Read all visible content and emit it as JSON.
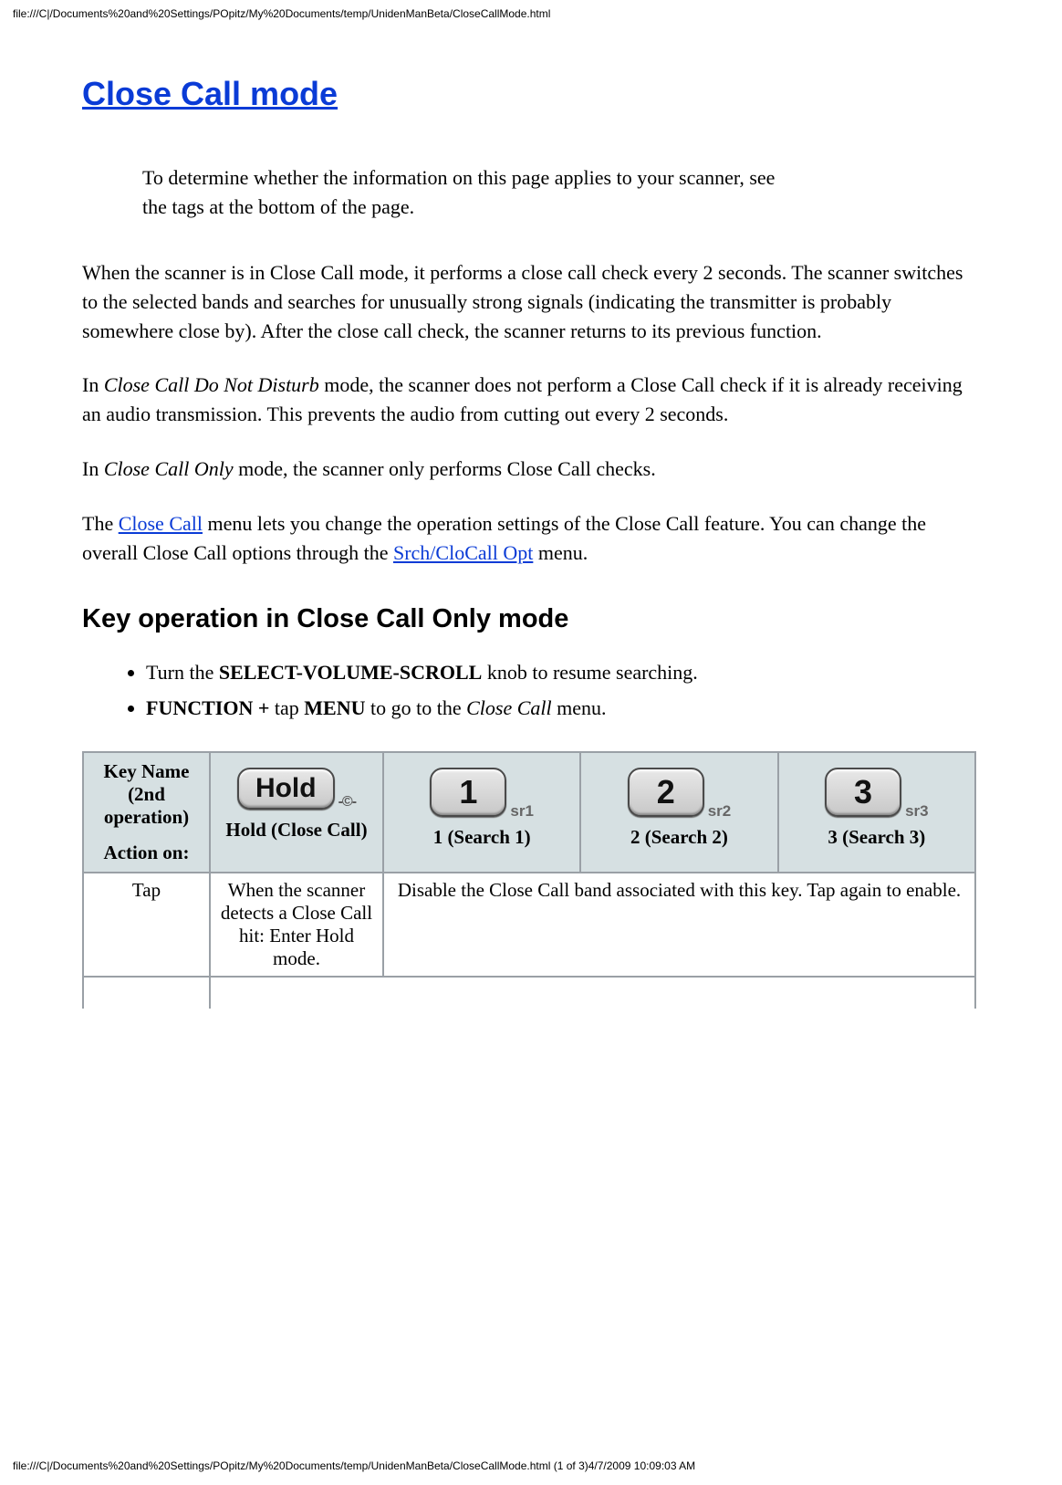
{
  "header_path": "file:///C|/Documents%20and%20Settings/POpitz/My%20Documents/temp/UnidenManBeta/CloseCallMode.html",
  "footer_path": "file:///C|/Documents%20and%20Settings/POpitz/My%20Documents/temp/UnidenManBeta/CloseCallMode.html (1 of 3)4/7/2009 10:09:03 AM",
  "title": "Close Call mode",
  "intro_note": "To determine whether the information on this page applies to your scanner, see the tags at the bottom of the page.",
  "para1": "When the scanner is in Close Call mode, it performs a close call check every 2 seconds. The scanner switches to the selected bands and searches for unusually strong signals (indicating the transmitter is probably somewhere close by). After the close call check, the scanner returns to its previous function.",
  "para2_pre": "In ",
  "para2_em": "Close Call Do Not Disturb",
  "para2_post": " mode, the scanner does not perform a Close Call check if it is already receiving an audio transmission. This prevents the audio from cutting out every 2 seconds.",
  "para3_pre": "In ",
  "para3_em": "Close Call Only",
  "para3_post": " mode, the scanner only performs Close Call checks.",
  "para4_pre": "The ",
  "para4_link1": "Close Call",
  "para4_mid": " menu lets you change the operation settings of the Close Call feature. You can change the overall Close Call options through the ",
  "para4_link2": "Srch/CloCall Opt",
  "para4_post": " menu.",
  "section_heading": "Key operation in Close Call Only mode",
  "bullet1_pre": "Turn the ",
  "bullet1_bold": "SELECT-VOLUME-SCROLL",
  "bullet1_post": " knob to resume searching.",
  "bullet2_b1": "FUNCTION +",
  "bullet2_mid": " tap ",
  "bullet2_b2": "MENU",
  "bullet2_post1": " to go to the ",
  "bullet2_em": "Close Call",
  "bullet2_post2": " menu.",
  "table": {
    "head_col_line1": "Key Name (2nd operation)",
    "head_col_line2": "Action on:",
    "keys": [
      {
        "cap": "Hold",
        "sub": "-©-",
        "label": "Hold (Close Call)"
      },
      {
        "cap": "1",
        "sub": "sr1",
        "label": "1 (Search 1)"
      },
      {
        "cap": "2",
        "sub": "sr2",
        "label": "2 (Search 2)"
      },
      {
        "cap": "3",
        "sub": "sr3",
        "label": "3 (Search 3)"
      }
    ],
    "row_label_tap": "Tap",
    "row_tap_hold": "When the scanner detects a Close Call hit: Enter Hold mode.",
    "row_tap_merged": "Disable the Close Call band associated with this key. Tap again to enable."
  }
}
